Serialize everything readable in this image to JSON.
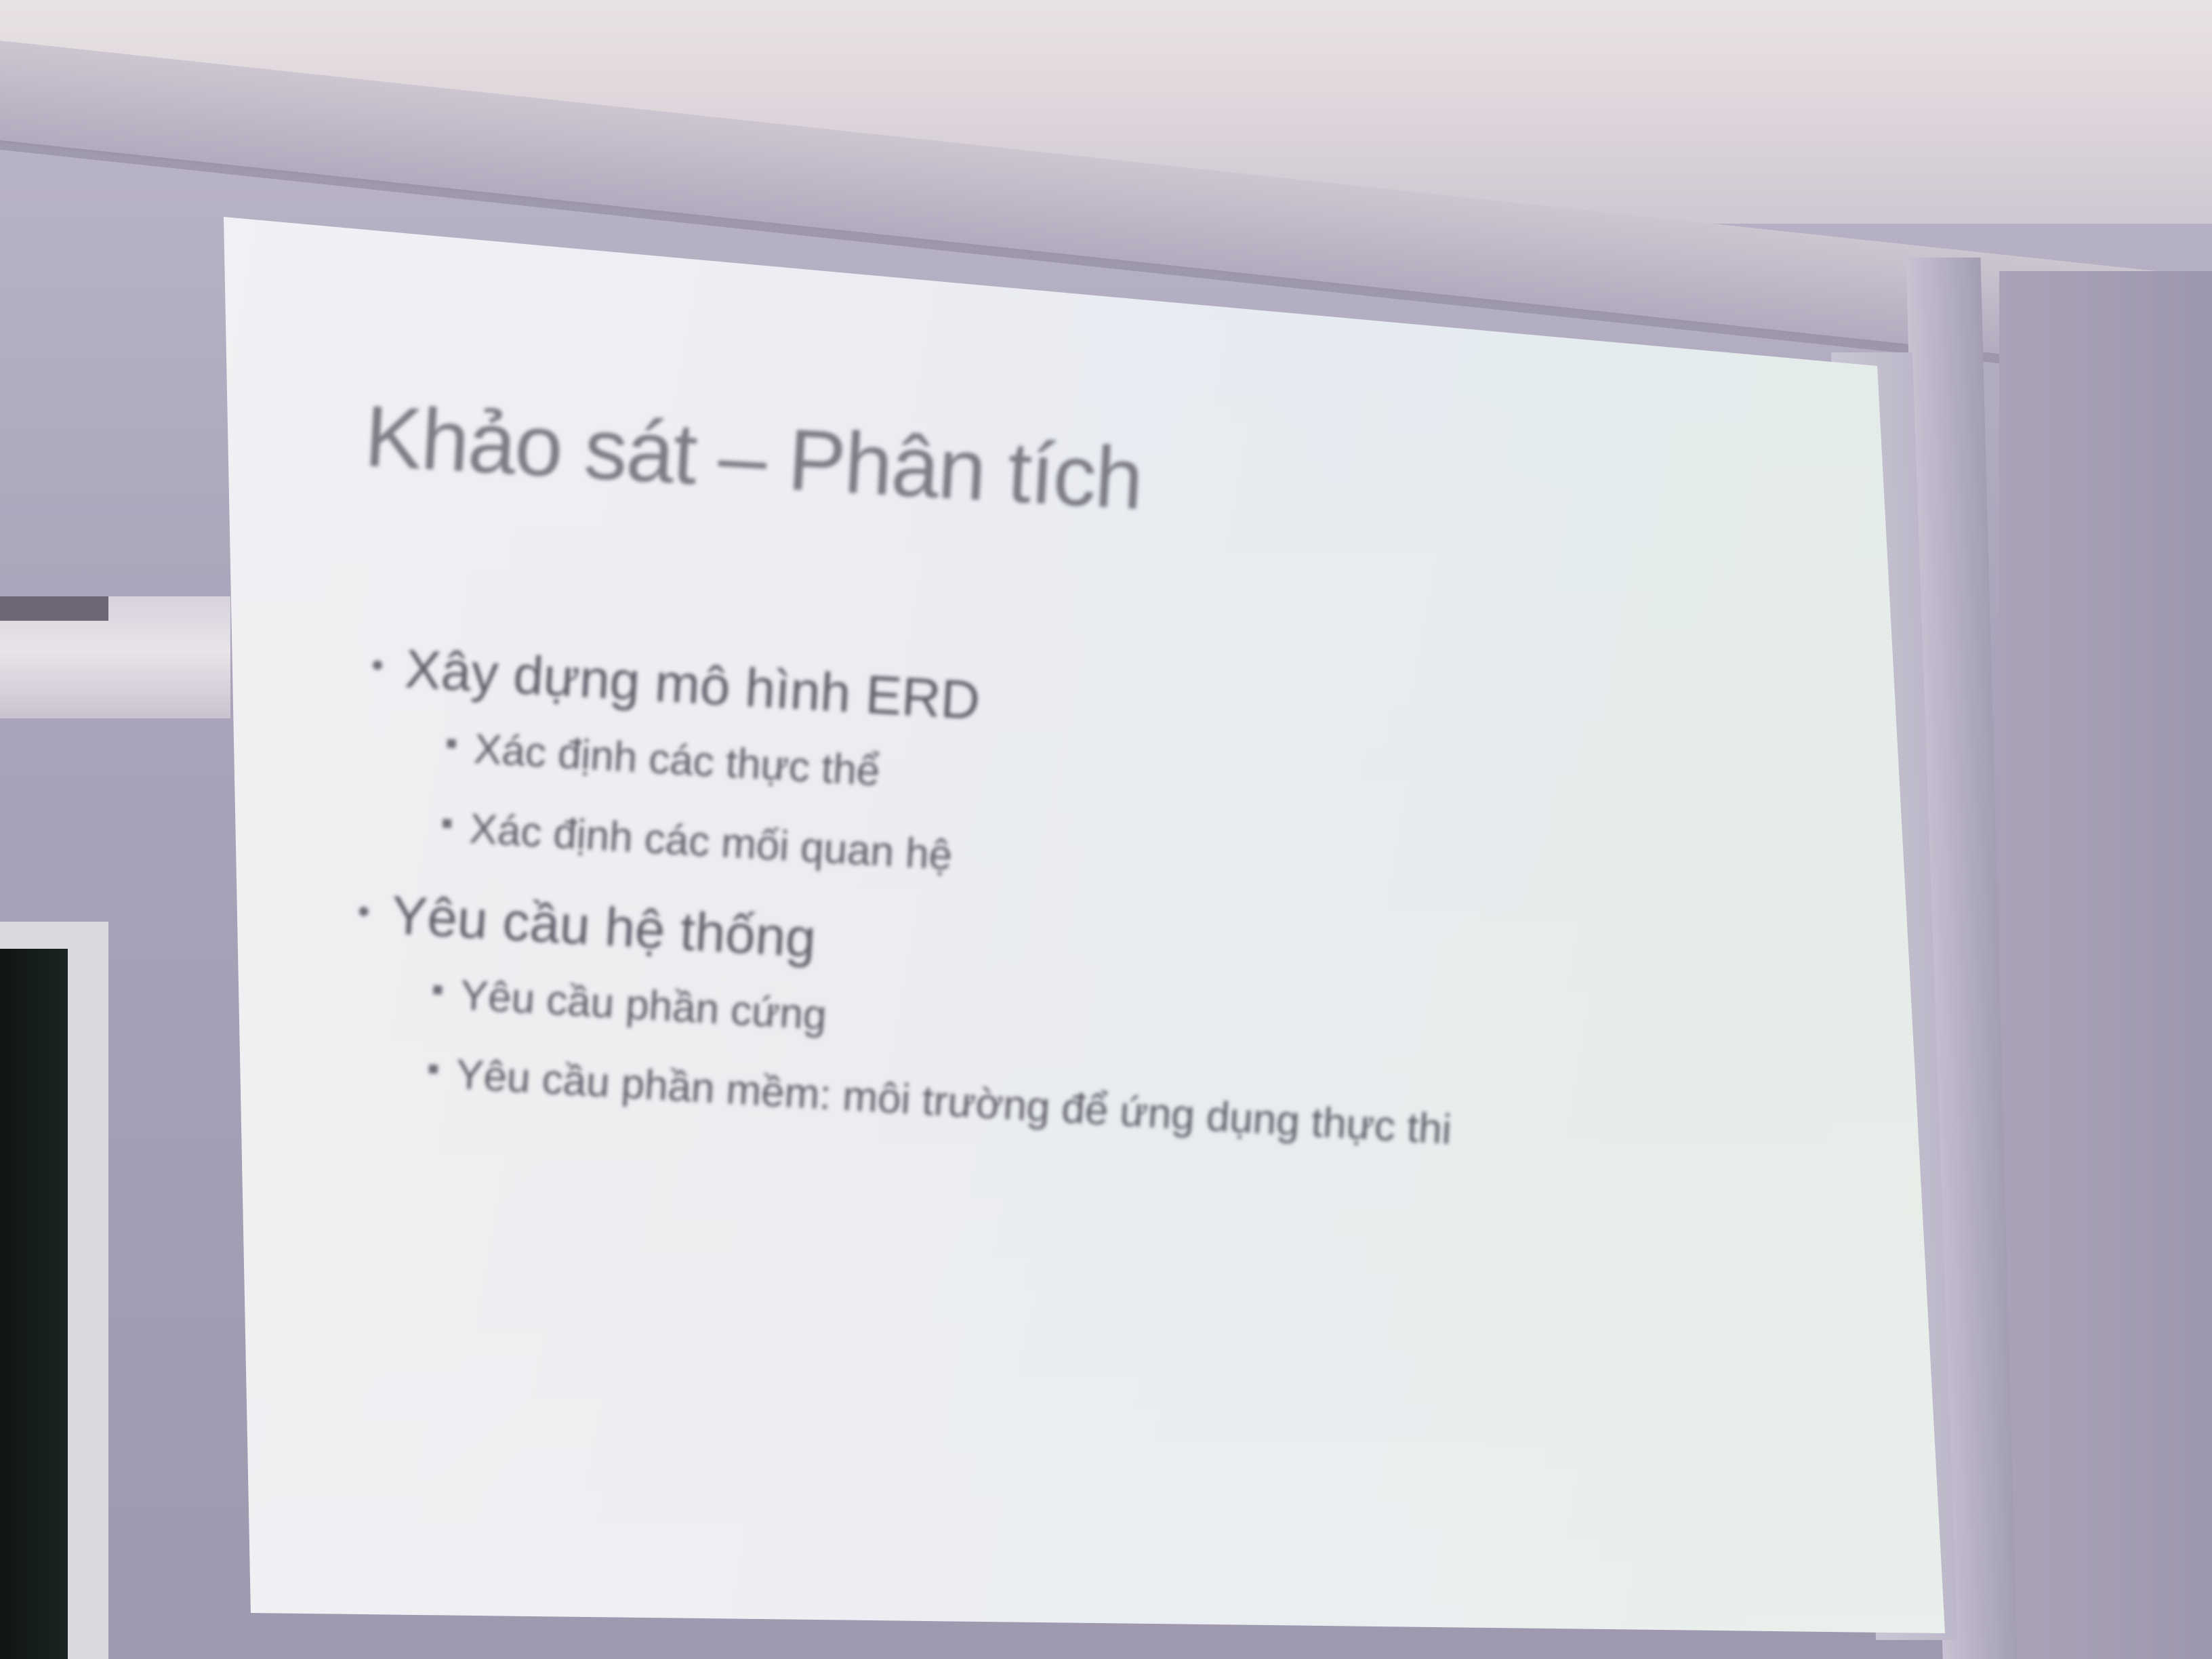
{
  "slide": {
    "title": "Khảo sát – Phân tích",
    "bullets": [
      {
        "text": "Xây dựng mô hình ERD",
        "sub": [
          "Xác định các thực thể",
          "Xác định các mối quan hệ"
        ]
      },
      {
        "text": "Yêu cầu hệ thống",
        "sub": [
          "Yêu cầu phần cứng",
          "Yêu cầu phần mềm: môi trường để ứng dụng thực thi"
        ]
      }
    ]
  }
}
